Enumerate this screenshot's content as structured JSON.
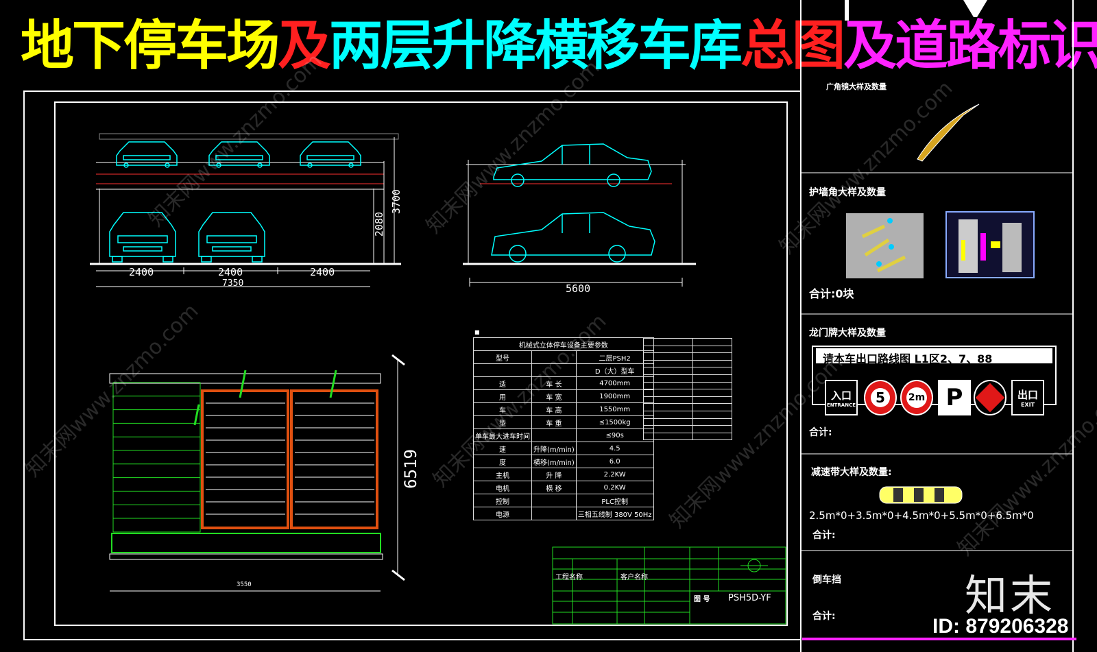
{
  "title": {
    "part1": "地下停车场",
    "part2": "及",
    "part3": "两层升降横移车库",
    "part4": "总图",
    "part5": "及道路标识"
  },
  "dims": {
    "w1": "2400",
    "w2": "2400",
    "w3": "2400",
    "total": "7350",
    "h_total": "3700",
    "h_lower": "2080",
    "side_len": "5600",
    "plan_h": "6519",
    "plan_w": "3550"
  },
  "params": {
    "caption": "机械式立体停车设备主要参数",
    "rows": [
      [
        "型号",
        "",
        "二层PSH2"
      ],
      [
        "",
        "",
        "D（大）型车"
      ],
      [
        "适",
        "车 长",
        "4700mm"
      ],
      [
        "用",
        "车 宽",
        "1900mm"
      ],
      [
        "车",
        "车 高",
        "1550mm"
      ],
      [
        "型",
        "车 重",
        "≤1500kg"
      ],
      [
        "单车最大进车时间",
        "",
        "≤90s"
      ],
      [
        "速",
        "升降(m/min)",
        "4.5"
      ],
      [
        "度",
        "横移(m/min)",
        "6.0"
      ],
      [
        "主机",
        "升 降",
        "2.2KW"
      ],
      [
        "电机",
        "横 移",
        "0.2KW"
      ],
      [
        "控制",
        "",
        "PLC控制"
      ],
      [
        "电源",
        "",
        "三相五线制 380V 50Hz"
      ]
    ]
  },
  "titleblock": {
    "drawing_no_label": "图 号",
    "drawing_no": "PSH5D-YF",
    "customer_label": "客户名称",
    "project_label": "工程名称"
  },
  "side": {
    "wide_corner_label": "广角镜大样及数量",
    "corner_guard_label": "护墙角大样及数量",
    "total_zero": "合计:0块",
    "gantry_label": "龙门牌大样及数量",
    "gantry_banner": "请本车出口路线图 L1区2、7、88",
    "total1": "合计:",
    "speed_bump_label": "减速带大样及数量:",
    "formula": "2.5m*0+3.5m*0+4.5m*0+5.5m*0+6.5m*0",
    "total2": "合计:",
    "wheel_stop_label": "倒车挡",
    "total3": "合计:"
  },
  "signs": {
    "entrance_cn": "入口",
    "entrance_en": "ENTRANCE",
    "speed": "5",
    "height": "2m",
    "parking": "P",
    "exit_cn": "出口",
    "exit_en": "EXIT"
  },
  "brand": {
    "logo": "知末",
    "id": "ID: 879206328"
  },
  "watermark": "知末网www.znzmo.com",
  "colors": {
    "yellow": "#ffff00",
    "red": "#ff2020",
    "cyan": "#00ffff",
    "magenta": "#ff22ff",
    "green": "#22dd22",
    "orange": "#e05010"
  }
}
